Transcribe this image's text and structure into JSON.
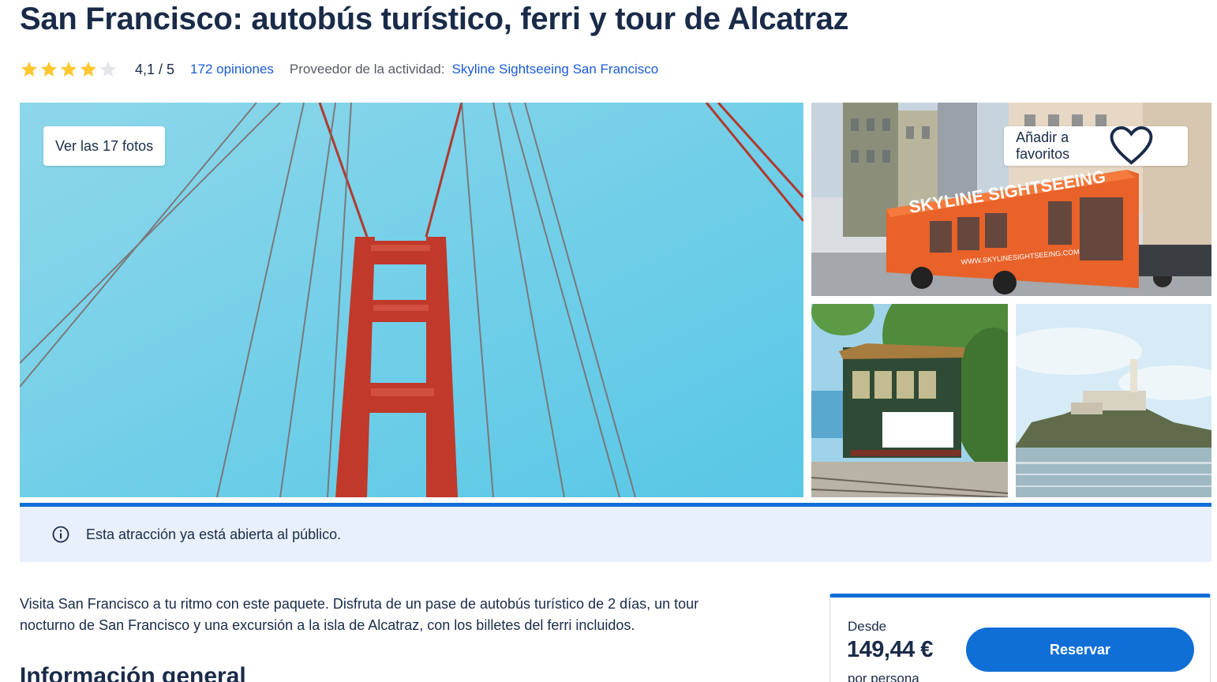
{
  "page": {
    "title": "San Francisco: autobús turístico, ferri y tour de Alcatraz"
  },
  "rating": {
    "stars_filled": 4,
    "stars_total": 5,
    "score_text": "4,1 / 5",
    "reviews_text": "172 opiniones",
    "provider_label": "Proveedor de la actividad:",
    "provider_name": "Skyline Sightseeing San Francisco"
  },
  "gallery": {
    "see_photos_label": "Ver las 17 fotos",
    "favorite_label": "Añadir a favoritos",
    "bus_text_1": "SKYLINE SIGHTSEEING",
    "bus_text_2": "WWW.SKYLINESIGHTSEEING.COM"
  },
  "notice": {
    "icon": "info-icon",
    "text": "Esta atracción ya está abierta al público."
  },
  "description": {
    "line1": "Visita San Francisco a tu ritmo con este paquete. Disfruta de un pase de autobús turístico de 2 días, un tour",
    "line2": "nocturno de San Francisco y una excursión a la isla de Alcatraz, con los billetes del ferri incluidos."
  },
  "section": {
    "heading": "Información general"
  },
  "booking": {
    "from_label": "Desde",
    "price": "149,44 €",
    "per_label": "por persona",
    "reserve_label": "Reservar"
  },
  "colors": {
    "accent": "#0f6fd6",
    "link": "#1a5bd6",
    "star": "#fdc72f",
    "star_empty": "#e4e6ea",
    "notice_bg": "#e8f0fb",
    "title": "#1a2b49"
  }
}
